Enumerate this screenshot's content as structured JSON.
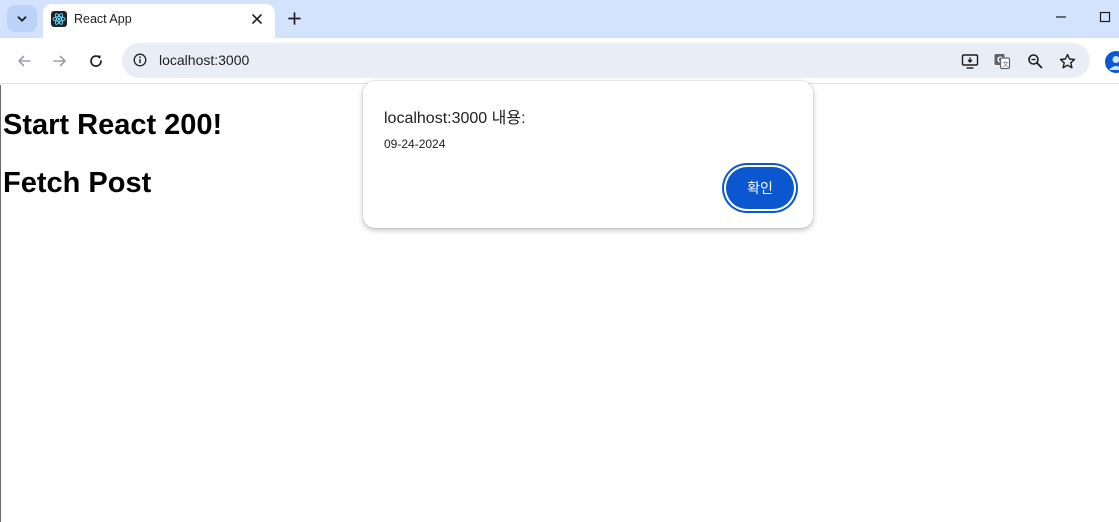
{
  "browser": {
    "tab": {
      "title": "React App",
      "favicon": "react-logo-icon"
    },
    "new_tab_icon": "plus-icon",
    "address_bar": {
      "url": "localhost:3000"
    },
    "toolbar_icons": [
      "back-icon",
      "forward-icon",
      "reload-icon",
      "install-app-icon",
      "translate-icon",
      "zoom-icon",
      "star-icon",
      "profile-icon"
    ],
    "accent_color": "#0b57d0",
    "tabstrip_color": "#d3e3fd"
  },
  "page": {
    "heading_1": "Start React 200!",
    "heading_2": "Fetch Post"
  },
  "alert": {
    "title": "localhost:3000 내용:",
    "message": "09-24-2024",
    "ok_label": "확인"
  }
}
